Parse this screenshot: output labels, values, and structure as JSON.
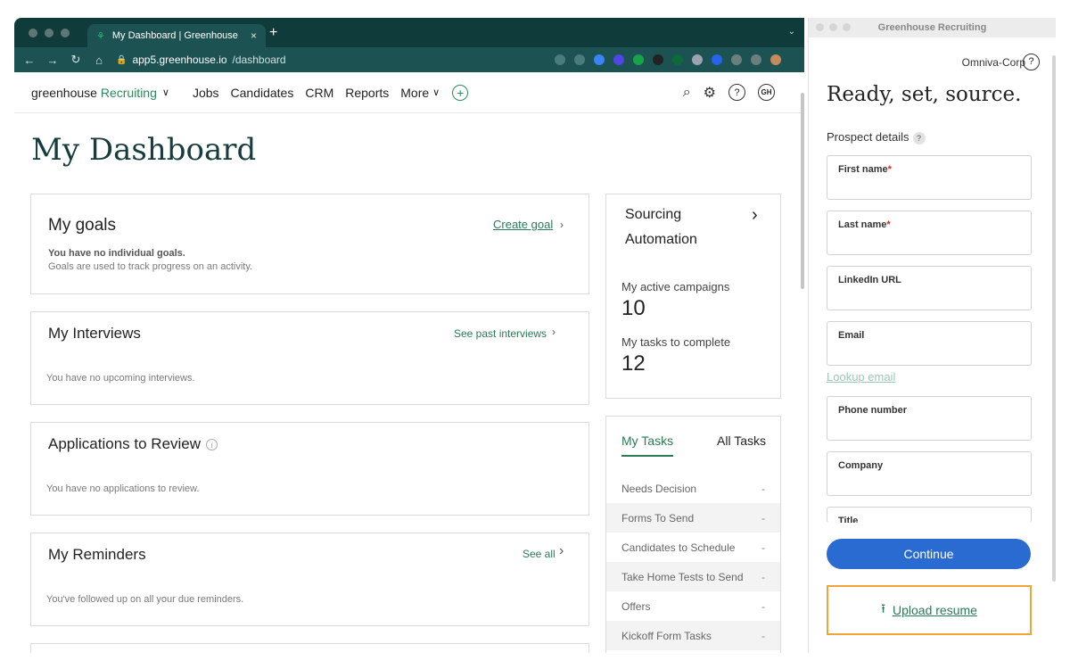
{
  "browser": {
    "tab_title": "My Dashboard | Greenhouse",
    "tab_close": "×",
    "new_tab": "+",
    "url_domain": "app5.greenhouse.io",
    "url_path": "/dashboard"
  },
  "nav": {
    "logo_main": "greenhouse",
    "logo_product": "Recruiting",
    "links": [
      "Jobs",
      "Candidates",
      "CRM",
      "Reports",
      "More"
    ],
    "avatar_initials": "GH",
    "help": "?"
  },
  "page": {
    "title": "My Dashboard"
  },
  "goals": {
    "title": "My goals",
    "link": "Create goal",
    "empty_strong": "You have no individual goals.",
    "empty_desc": "Goals are used to track progress on an activity."
  },
  "interviews": {
    "title": "My Interviews",
    "link": "See past interviews",
    "empty": "You have no upcoming interviews."
  },
  "applications": {
    "title": "Applications to Review",
    "info": "i",
    "empty": "You have no applications to review."
  },
  "reminders": {
    "title": "My Reminders",
    "link": "See all",
    "empty": "You've followed up on all your due reminders."
  },
  "sourcing": {
    "title": "Sourcing Automation",
    "campaigns_label": "My active campaigns",
    "campaigns_value": "10",
    "tasks_label": "My tasks to complete",
    "tasks_value": "12"
  },
  "tasks": {
    "tab_mine": "My Tasks",
    "tab_all": "All Tasks",
    "rows": [
      {
        "label": "Needs Decision",
        "value": "-"
      },
      {
        "label": "Forms To Send",
        "value": "-"
      },
      {
        "label": "Candidates to Schedule",
        "value": "-"
      },
      {
        "label": "Take Home Tests to Send",
        "value": "-"
      },
      {
        "label": "Offers",
        "value": "-"
      },
      {
        "label": "Kickoff Form Tasks",
        "value": "-"
      }
    ]
  },
  "extension": {
    "window_title": "Greenhouse Recruiting",
    "org": "Omniva-Corp",
    "heading": "Ready, set, source.",
    "section": "Prospect details",
    "fields": {
      "first_name": "First name",
      "last_name": "Last name",
      "linkedin": "LinkedIn URL",
      "email": "Email",
      "phone": "Phone number",
      "company": "Company",
      "title": "Title"
    },
    "required_mark": "*",
    "lookup": "Lookup email",
    "continue": "Continue",
    "upload": "Upload resume"
  },
  "colors": {
    "brand_green": "#2a7a55",
    "dark_teal": "#0f3b3b",
    "primary_blue": "#2a6bd1",
    "highlight_orange": "#f0a43a"
  }
}
